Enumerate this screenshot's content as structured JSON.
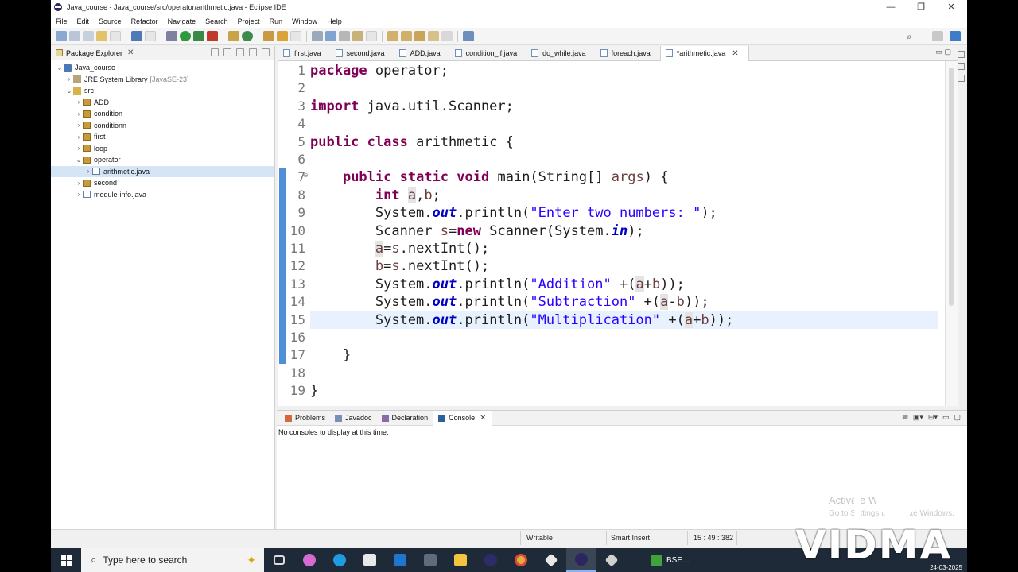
{
  "window": {
    "title": "Java_course - Java_course/src/operator/arithmetic.java - Eclipse IDE",
    "controls": {
      "minimize": "—",
      "maximize": "❐",
      "close": "✕"
    }
  },
  "menu": [
    "File",
    "Edit",
    "Source",
    "Refactor",
    "Navigate",
    "Search",
    "Project",
    "Run",
    "Window",
    "Help"
  ],
  "package_explorer": {
    "title": "Package Explorer",
    "tree": [
      {
        "label": "Java_course",
        "indent": 0,
        "twisty": "⌄",
        "icon": "project"
      },
      {
        "label": "JRE System Library",
        "suffix": "[JavaSE-23]",
        "indent": 1,
        "twisty": "›",
        "icon": "library"
      },
      {
        "label": "src",
        "indent": 1,
        "twisty": "⌄",
        "icon": "folder"
      },
      {
        "label": "ADD",
        "indent": 2,
        "twisty": "›",
        "icon": "package"
      },
      {
        "label": "condition",
        "indent": 2,
        "twisty": "›",
        "icon": "package"
      },
      {
        "label": "conditionn",
        "indent": 2,
        "twisty": "›",
        "icon": "package"
      },
      {
        "label": "first",
        "indent": 2,
        "twisty": "›",
        "icon": "package"
      },
      {
        "label": "loop",
        "indent": 2,
        "twisty": "›",
        "icon": "package"
      },
      {
        "label": "operator",
        "indent": 2,
        "twisty": "⌄",
        "icon": "package"
      },
      {
        "label": "arithmetic.java",
        "indent": 3,
        "twisty": "›",
        "icon": "java",
        "selected": true
      },
      {
        "label": "second",
        "indent": 2,
        "twisty": "›",
        "icon": "package"
      },
      {
        "label": "module-info.java",
        "indent": 2,
        "twisty": "›",
        "icon": "java"
      }
    ]
  },
  "editor": {
    "tabs": [
      {
        "label": "first.java"
      },
      {
        "label": "second.java"
      },
      {
        "label": "ADD.java"
      },
      {
        "label": "condition_if.java"
      },
      {
        "label": "do_while.java"
      },
      {
        "label": "foreach.java"
      },
      {
        "label": "*arithmetic.java",
        "active": true
      }
    ],
    "tab_close": "✕",
    "current_line": 15,
    "lines": [
      {
        "n": "1",
        "tokens": [
          {
            "t": "package",
            "c": "kw"
          },
          {
            "t": " operator;"
          }
        ]
      },
      {
        "n": "2",
        "tokens": []
      },
      {
        "n": "3",
        "tokens": [
          {
            "t": "import",
            "c": "kw"
          },
          {
            "t": " java.util.Scanner;"
          }
        ]
      },
      {
        "n": "4",
        "tokens": []
      },
      {
        "n": "5",
        "tokens": [
          {
            "t": "public",
            "c": "kw"
          },
          {
            "t": " "
          },
          {
            "t": "class",
            "c": "kw"
          },
          {
            "t": " arithmetic {"
          }
        ]
      },
      {
        "n": "6",
        "tokens": []
      },
      {
        "n": "7",
        "fold": "⊖",
        "tokens": [
          {
            "t": "    "
          },
          {
            "t": "public",
            "c": "kw"
          },
          {
            "t": " "
          },
          {
            "t": "static",
            "c": "kw"
          },
          {
            "t": " "
          },
          {
            "t": "void",
            "c": "kw"
          },
          {
            "t": " main(String[] "
          },
          {
            "t": "args",
            "c": "var"
          },
          {
            "t": ") {"
          }
        ]
      },
      {
        "n": "8",
        "tokens": [
          {
            "t": "        "
          },
          {
            "t": "int",
            "c": "kw"
          },
          {
            "t": " "
          },
          {
            "t": "a",
            "c": "var occ"
          },
          {
            "t": ","
          },
          {
            "t": "b",
            "c": "var"
          },
          {
            "t": ";"
          }
        ]
      },
      {
        "n": "9",
        "tokens": [
          {
            "t": "        System."
          },
          {
            "t": "out",
            "c": "fld"
          },
          {
            "t": ".println("
          },
          {
            "t": "\"Enter two numbers: \"",
            "c": "str"
          },
          {
            "t": ");"
          }
        ]
      },
      {
        "n": "10",
        "tokens": [
          {
            "t": "        Scanner "
          },
          {
            "t": "s",
            "c": "var"
          },
          {
            "t": "="
          },
          {
            "t": "new",
            "c": "kw"
          },
          {
            "t": " Scanner(System."
          },
          {
            "t": "in",
            "c": "fld"
          },
          {
            "t": ");"
          }
        ]
      },
      {
        "n": "11",
        "tokens": [
          {
            "t": "        "
          },
          {
            "t": "a",
            "c": "var occ"
          },
          {
            "t": "="
          },
          {
            "t": "s",
            "c": "var"
          },
          {
            "t": ".nextInt();"
          }
        ]
      },
      {
        "n": "12",
        "tokens": [
          {
            "t": "        "
          },
          {
            "t": "b",
            "c": "var"
          },
          {
            "t": "="
          },
          {
            "t": "s",
            "c": "var"
          },
          {
            "t": ".nextInt();"
          }
        ]
      },
      {
        "n": "13",
        "tokens": [
          {
            "t": "        System."
          },
          {
            "t": "out",
            "c": "fld"
          },
          {
            "t": ".println("
          },
          {
            "t": "\"Addition\"",
            "c": "str"
          },
          {
            "t": " +("
          },
          {
            "t": "a",
            "c": "var occ"
          },
          {
            "t": "+"
          },
          {
            "t": "b",
            "c": "var"
          },
          {
            "t": "));"
          }
        ]
      },
      {
        "n": "14",
        "tokens": [
          {
            "t": "        System."
          },
          {
            "t": "out",
            "c": "fld"
          },
          {
            "t": ".println("
          },
          {
            "t": "\"Subtraction\"",
            "c": "str"
          },
          {
            "t": " +("
          },
          {
            "t": "a",
            "c": "var occ"
          },
          {
            "t": "-"
          },
          {
            "t": "b",
            "c": "var"
          },
          {
            "t": "));"
          }
        ]
      },
      {
        "n": "15",
        "tokens": [
          {
            "t": "        System."
          },
          {
            "t": "out",
            "c": "fld"
          },
          {
            "t": ".println("
          },
          {
            "t": "\"Multiplication\"",
            "c": "str"
          },
          {
            "t": " +("
          },
          {
            "t": "a",
            "c": "var occ"
          },
          {
            "t": "+"
          },
          {
            "t": "b",
            "c": "var"
          },
          {
            "t": "));"
          }
        ]
      },
      {
        "n": "16",
        "tokens": []
      },
      {
        "n": "17",
        "tokens": [
          {
            "t": "    }"
          }
        ]
      },
      {
        "n": "18",
        "tokens": []
      },
      {
        "n": "19",
        "tokens": [
          {
            "t": "}"
          }
        ]
      }
    ]
  },
  "bottom_panel": {
    "tabs": [
      {
        "label": "Problems"
      },
      {
        "label": "Javadoc"
      },
      {
        "label": "Declaration"
      },
      {
        "label": "Console",
        "active": true
      }
    ],
    "close": "✕",
    "message": "No consoles to display at this time.",
    "activate_title": "Activate Windows",
    "activate_sub": "Go to Settings to activate Windows."
  },
  "status": {
    "writable": "Writable",
    "insert_mode": "Smart Insert",
    "position": "15 : 49 : 382"
  },
  "taskbar": {
    "search_placeholder": "Type here to search",
    "bse_label": "BSE...",
    "clock": "24-03-2025"
  },
  "watermark": {
    "text": "VIDMA"
  },
  "colors": {
    "keyword": "#7f0055",
    "string": "#2a00ff",
    "field": "#0000c0",
    "variable": "#6a3e3e",
    "current_line": "#e8f2fe",
    "selection": "#d5e5f6",
    "quick_diff": "#4f8fd7"
  }
}
